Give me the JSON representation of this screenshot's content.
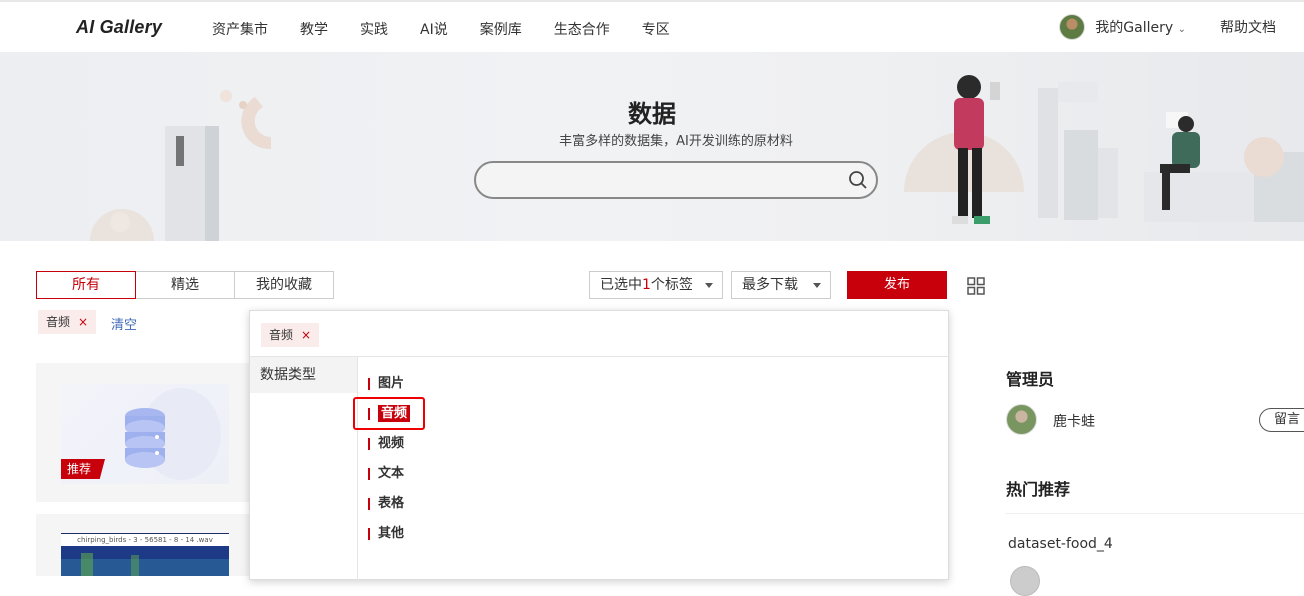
{
  "nav": {
    "logo": "AI Gallery",
    "menu": [
      "资产集市",
      "教学",
      "实践",
      "AI说",
      "案例库",
      "生态合作",
      "专区"
    ],
    "my_gallery": "我的Gallery",
    "help": "帮助文档"
  },
  "banner": {
    "title": "数据",
    "subtitle": "丰富多样的数据集，AI开发训练的原材料",
    "search_placeholder": ""
  },
  "tabs": [
    "所有",
    "精选",
    "我的收藏"
  ],
  "filters": {
    "tags_prefix": "已选中",
    "tags_count": "1",
    "tags_suffix": "个标签",
    "sort": "最多下载",
    "publish": "发布"
  },
  "selected_chip": {
    "label": "音频",
    "remove": "×"
  },
  "clear": "清空",
  "cards": [
    {
      "badge": "推荐"
    },
    {
      "caption": "chirping_birds - 3 - 56581 - 8 - 14 .wav"
    }
  ],
  "popup": {
    "chip": "音频",
    "chip_remove": "×",
    "category": "数据类型",
    "options": [
      "图片",
      "音频",
      "视频",
      "文本",
      "表格",
      "其他"
    ],
    "selected": "音频"
  },
  "sidebar": {
    "admin_title": "管理员",
    "admin_name": "鹿卡蛙",
    "message_btn": "留言",
    "hot_title": "热门推荐",
    "hot_items": [
      "dataset-food_4"
    ]
  },
  "colors": {
    "accent": "#c7000b",
    "link": "#406ab8"
  }
}
